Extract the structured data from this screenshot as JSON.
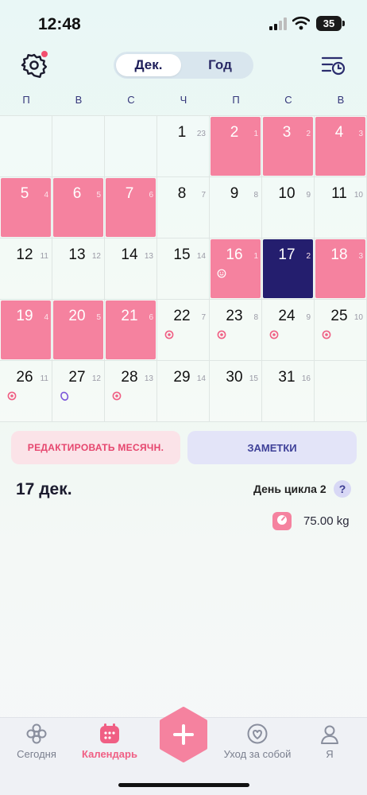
{
  "status_bar": {
    "time": "12:48",
    "battery": "35"
  },
  "header": {
    "segment": {
      "active": "Дек.",
      "inactive": "Год"
    }
  },
  "weekdays": [
    "П",
    "В",
    "С",
    "Ч",
    "П",
    "С",
    "В"
  ],
  "calendar": {
    "cells": [
      {
        "day": "",
        "cycle": "",
        "state": "empty",
        "marker": ""
      },
      {
        "day": "",
        "cycle": "",
        "state": "empty",
        "marker": ""
      },
      {
        "day": "",
        "cycle": "",
        "state": "empty",
        "marker": ""
      },
      {
        "day": "1",
        "cycle": "23",
        "state": "normal",
        "marker": ""
      },
      {
        "day": "2",
        "cycle": "1",
        "state": "period",
        "marker": ""
      },
      {
        "day": "3",
        "cycle": "2",
        "state": "period",
        "marker": ""
      },
      {
        "day": "4",
        "cycle": "3",
        "state": "period",
        "marker": ""
      },
      {
        "day": "5",
        "cycle": "4",
        "state": "period",
        "marker": ""
      },
      {
        "day": "6",
        "cycle": "5",
        "state": "period",
        "marker": ""
      },
      {
        "day": "7",
        "cycle": "6",
        "state": "period",
        "marker": ""
      },
      {
        "day": "8",
        "cycle": "7",
        "state": "normal",
        "marker": ""
      },
      {
        "day": "9",
        "cycle": "8",
        "state": "normal",
        "marker": ""
      },
      {
        "day": "10",
        "cycle": "9",
        "state": "normal",
        "marker": ""
      },
      {
        "day": "11",
        "cycle": "10",
        "state": "normal",
        "marker": ""
      },
      {
        "day": "12",
        "cycle": "11",
        "state": "normal",
        "marker": ""
      },
      {
        "day": "13",
        "cycle": "12",
        "state": "normal",
        "marker": ""
      },
      {
        "day": "14",
        "cycle": "13",
        "state": "normal",
        "marker": ""
      },
      {
        "day": "15",
        "cycle": "14",
        "state": "normal",
        "marker": ""
      },
      {
        "day": "16",
        "cycle": "1",
        "state": "period",
        "marker": "smiley"
      },
      {
        "day": "17",
        "cycle": "2",
        "state": "selected",
        "marker": ""
      },
      {
        "day": "18",
        "cycle": "3",
        "state": "period",
        "marker": ""
      },
      {
        "day": "19",
        "cycle": "4",
        "state": "period",
        "marker": ""
      },
      {
        "day": "20",
        "cycle": "5",
        "state": "period",
        "marker": ""
      },
      {
        "day": "21",
        "cycle": "6",
        "state": "period",
        "marker": ""
      },
      {
        "day": "22",
        "cycle": "7",
        "state": "normal",
        "marker": "dot"
      },
      {
        "day": "23",
        "cycle": "8",
        "state": "normal",
        "marker": "dot"
      },
      {
        "day": "24",
        "cycle": "9",
        "state": "normal",
        "marker": "dot"
      },
      {
        "day": "25",
        "cycle": "10",
        "state": "normal",
        "marker": "dot"
      },
      {
        "day": "26",
        "cycle": "11",
        "state": "normal",
        "marker": "dot"
      },
      {
        "day": "27",
        "cycle": "12",
        "state": "normal",
        "marker": "egg"
      },
      {
        "day": "28",
        "cycle": "13",
        "state": "normal",
        "marker": "dot"
      },
      {
        "day": "29",
        "cycle": "14",
        "state": "normal",
        "marker": ""
      },
      {
        "day": "30",
        "cycle": "15",
        "state": "normal",
        "marker": ""
      },
      {
        "day": "31",
        "cycle": "16",
        "state": "normal",
        "marker": ""
      },
      {
        "day": "",
        "cycle": "",
        "state": "empty",
        "marker": ""
      }
    ]
  },
  "actions": {
    "edit_period": "РЕДАКТИРОВАТЬ МЕСЯЧН.",
    "notes": "ЗАМЕТКИ"
  },
  "day_info": {
    "date": "17 дек.",
    "cycle_day": "День цикла 2",
    "help": "?",
    "weight": "75.00 kg"
  },
  "bottom_nav": {
    "today": "Сегодня",
    "calendar": "Календарь",
    "selfcare": "Уход за собой",
    "me": "Я"
  },
  "colors": {
    "period": "#f5829f",
    "selected": "#241e6e",
    "accent_pink": "#f05f84",
    "text_navy": "#34367a"
  }
}
